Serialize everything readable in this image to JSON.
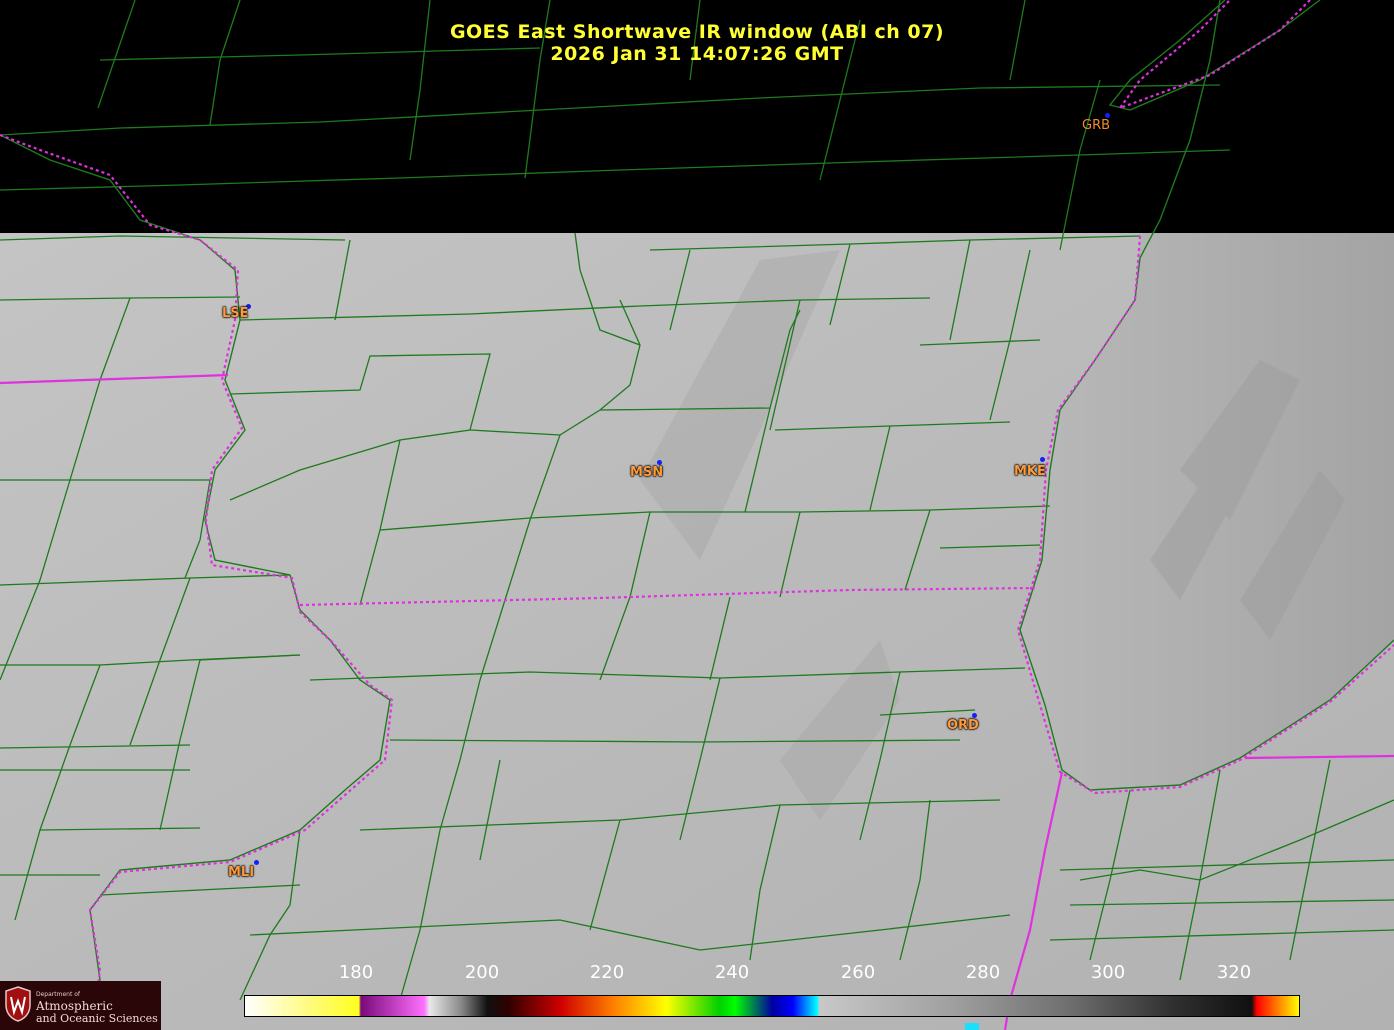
{
  "title": {
    "line1": "GOES East Shortwave IR window (ABI ch 07)",
    "line2": "2026 Jan 31  14:07:26 GMT"
  },
  "colors": {
    "county_lines": "#1e7a1e",
    "state_borders": "#e030e0",
    "title_text": "#ffff33",
    "station_label": "#ff9a3a",
    "station_dot": "#1020ff",
    "no_data": "#000000"
  },
  "stations": [
    {
      "id": "GRB",
      "label": "GRB"
    },
    {
      "id": "LSE",
      "label": "LSE"
    },
    {
      "id": "MSN",
      "label": "MSN"
    },
    {
      "id": "MKE",
      "label": "MKE"
    },
    {
      "id": "ORD",
      "label": "ORD"
    },
    {
      "id": "MLI",
      "label": "MLI"
    }
  ],
  "colorbar": {
    "unit_note": "",
    "tick_labels": [
      "180",
      "200",
      "220",
      "240",
      "260",
      "280",
      "300",
      "320"
    ],
    "range": [
      173,
      340
    ]
  },
  "logo": {
    "line1": "Department of",
    "line2": "Atmospheric",
    "line3": "and Oceanic Sciences",
    "seal_icon": "uw-crest-icon"
  }
}
